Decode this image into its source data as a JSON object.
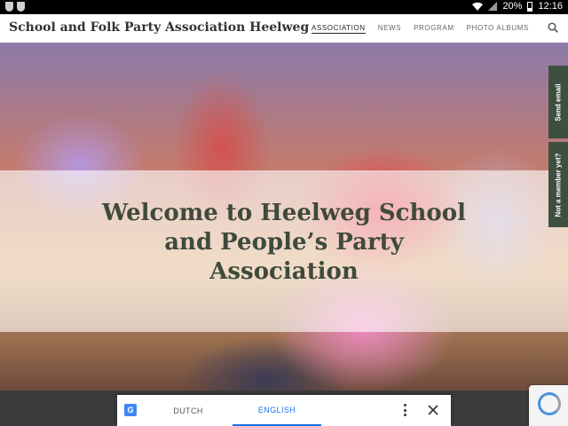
{
  "status_bar": {
    "battery": "20%",
    "time": "12:16"
  },
  "header": {
    "site_title": "School and Folk Party Association Heelweg",
    "nav": [
      {
        "label": "ASSOCIATION",
        "active": true
      },
      {
        "label": "NEWS",
        "active": false
      },
      {
        "label": "PROGRAM",
        "active": false
      },
      {
        "label": "PHOTO ALBUMS",
        "active": false
      }
    ]
  },
  "hero": {
    "heading": "Welcome to Heelweg School and People’s Party Association"
  },
  "side_tabs": {
    "send_email": "Send email",
    "member": "Not a member yet?"
  },
  "translate_bar": {
    "source_lang": "DUTCH",
    "target_lang": "ENGLISH",
    "active": "ENGLISH"
  },
  "colors": {
    "side_tab_bg": "#3d4f3f",
    "heading_text": "#3f4a3c",
    "translate_accent": "#1a73e8"
  }
}
